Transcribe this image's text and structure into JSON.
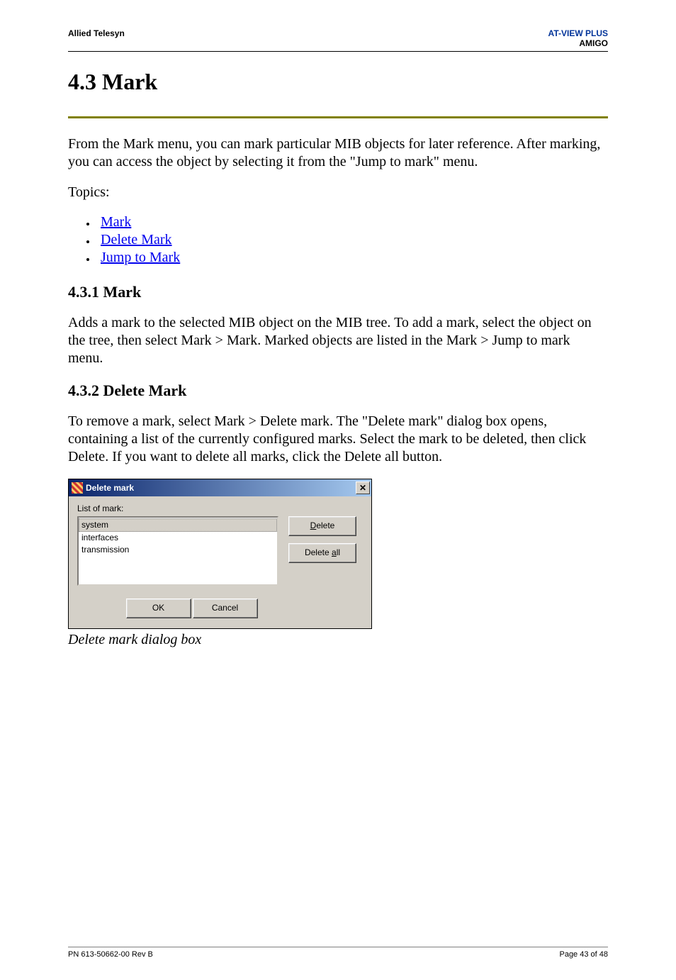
{
  "header": {
    "left": "Allied Telesyn",
    "right_line1": "AT-VIEW PLUS",
    "right_line2": "AMIGO"
  },
  "title": "4.3 Mark",
  "intro": "From the Mark menu, you can mark particular MIB objects for later reference. After marking, you can access the object by selecting it from the \"Jump to mark\" menu.",
  "topics_label": "Topics:",
  "links": {
    "mark": "Mark",
    "delete_mark": "Delete Mark",
    "jump_to_mark": "Jump to Mark"
  },
  "sub1": {
    "title": "4.3.1 Mark",
    "body": "Adds a mark to the selected MIB object on the MIB tree. To add a mark, select the object on the tree, then select Mark > Mark. Marked objects are listed in the Mark > Jump to mark menu."
  },
  "sub2": {
    "title": "4.3.2 Delete Mark",
    "body": "To remove a mark, select Mark > Delete mark. The \"Delete mark\" dialog box opens, containing a list of the currently configured marks. Select the mark to be deleted, then click Delete. If you want to delete all marks, click the Delete all button."
  },
  "dialog": {
    "title": "Delete mark",
    "list_label": "List of mark:",
    "items": {
      "i0": "system",
      "i1": "interfaces",
      "i2": "transmission"
    },
    "delete_btn_pre": "",
    "delete_btn_u": "D",
    "delete_btn_post": "elete",
    "delete_all_pre": "Delete ",
    "delete_all_u": "a",
    "delete_all_post": "ll",
    "ok": "OK",
    "cancel": "Cancel",
    "close_glyph": "✕"
  },
  "caption": "Delete mark dialog box",
  "footer": {
    "left": "PN 613-50662-00 Rev B",
    "right": "Page 43 of 48"
  }
}
